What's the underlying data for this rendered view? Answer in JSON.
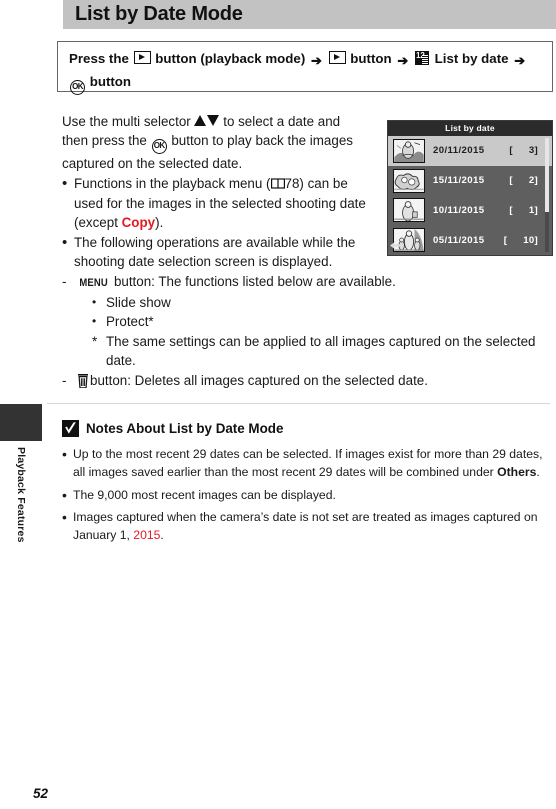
{
  "page": {
    "title": "List by Date Mode",
    "number": "52",
    "side_tab_label": "Playback Features"
  },
  "instruction": {
    "part1": "Press the",
    "part2": "button (playback mode)",
    "part3": "button",
    "part4": "List by date",
    "part5": "button",
    "icon_playback": "playback-icon",
    "icon_arrow": "➔",
    "icon_calendar": "list-by-date-icon",
    "icon_ok": "OK"
  },
  "body": {
    "intro": {
      "pre": "Use the multi selector",
      "mid": "to select a date and then press the",
      "post": "button to play back the images captured on the selected date."
    },
    "bullets": [
      {
        "pre": "Functions in the playback menu (",
        "ref": "78",
        "mid": ") can be used for the images in the selected shooting date (except ",
        "emph": "Copy",
        "post": ")."
      },
      {
        "text": "The following operations are available while the shooting date selection screen is displayed."
      }
    ],
    "sub_items": [
      {
        "dash": "-",
        "icon_label": "MENU",
        "text": "button: The functions listed below are available."
      }
    ],
    "menu_functions": [
      "Slide show",
      "Protect*"
    ],
    "footnote": {
      "mark": "*",
      "text": "The same settings can be applied to all images captured on the selected date."
    },
    "delete_item": {
      "dash": "-",
      "icon": "trash-icon",
      "text": "button: Deletes all images captured on the selected date."
    }
  },
  "camera_screen": {
    "title": "List by date",
    "rows": [
      {
        "date": "20/11/2015",
        "count": "3",
        "selected": true
      },
      {
        "date": "15/11/2015",
        "count": "2",
        "selected": false
      },
      {
        "date": "10/11/2015",
        "count": "1",
        "selected": false
      },
      {
        "date": "05/11/2015",
        "count": "10",
        "selected": false
      }
    ],
    "bracket_left": "[",
    "bracket_right": "]"
  },
  "notes": {
    "heading": "Notes About List by Date Mode",
    "icon": "checkmark-icon",
    "items": [
      {
        "pre": "Up to the most recent 29 dates can be selected. If images exist for more than 29 dates, all images saved earlier than the most recent 29 dates will be combined under ",
        "emph": "Others",
        "post": "."
      },
      {
        "pre": "The 9,000 most recent images can be displayed.",
        "emph": "",
        "post": ""
      },
      {
        "pre": "Images captured when the camera’s date is not set are treated as images captured on January 1, ",
        "emph_red": "2015",
        "post": "."
      }
    ]
  },
  "colors": {
    "header_bar": "#c2c2c2",
    "accent_red": "#e31b23",
    "screen_bg": "#5f5f5f",
    "screen_title_bg": "#2b2b2b",
    "selected_row": "#c9c9c9",
    "side_tab": "#333333"
  }
}
